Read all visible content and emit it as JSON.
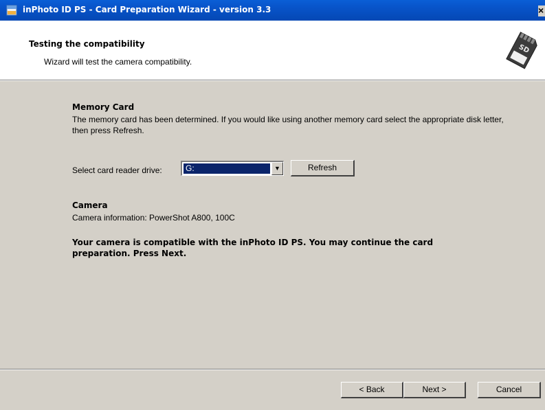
{
  "window": {
    "title": "inPhoto ID PS - Card Preparation Wizard - version 3.3",
    "close_glyph": "×"
  },
  "header": {
    "title": "Testing the compatibility",
    "subtitle": "Wizard will test the camera compatibility.",
    "icon": "sd-card-icon"
  },
  "memory_card": {
    "title": "Memory Card",
    "description": "The memory card has been determined. If you would like using another memory card select the appropriate disk letter, then press Refresh.",
    "drive_label": "Select card reader drive:",
    "drive_value": "G:",
    "refresh_label": "Refresh"
  },
  "camera": {
    "title": "Camera",
    "info": "Camera information: PowerShot A800, 100C",
    "compat_message": "Your camera is compatible with the inPhoto ID PS. You may continue the card preparation. Press Next."
  },
  "footer": {
    "back_label": "< Back",
    "next_label": "Next >",
    "cancel_label": "Cancel"
  },
  "colors": {
    "titlebar": "#0853c8",
    "dialog_bg": "#d4d0c8",
    "selection": "#0a246a"
  }
}
